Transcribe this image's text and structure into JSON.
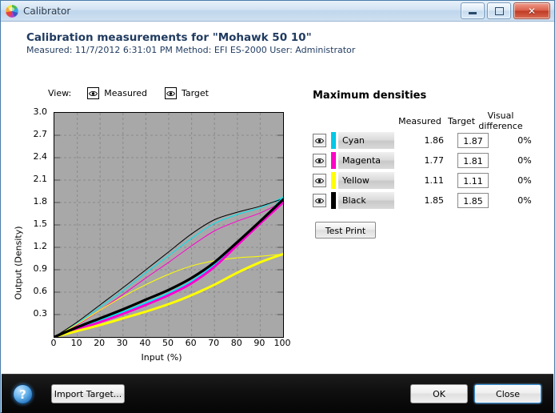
{
  "window": {
    "title": "Calibrator",
    "icon": "color-wheel-icon",
    "buttons": {
      "minimize": "minimize-icon",
      "maximize": "maximize-icon",
      "close": "close-icon"
    }
  },
  "header": {
    "title": "Calibration measurements for \"Mohawk 50 10\"",
    "subtitle": "Measured: 11/7/2012 6:31:01 PM   Method: EFI ES-2000   User: Administrator"
  },
  "view": {
    "label": "View:",
    "options": [
      {
        "label": "Measured",
        "icon": "eye-icon",
        "enabled": true
      },
      {
        "label": "Target",
        "icon": "eye-icon",
        "enabled": true
      }
    ]
  },
  "panel": {
    "title": "Maximum densities",
    "columns": [
      "Measured",
      "Target",
      "Visual difference"
    ],
    "column_visual_line1": "Visual",
    "column_visual_line2": "difference",
    "rows": [
      {
        "name": "Cyan",
        "color": "#00c8e6",
        "measured": "1.86",
        "target": "1.87",
        "visual_difference": "0%",
        "icon": "eye-icon"
      },
      {
        "name": "Magenta",
        "color": "#ff00c8",
        "measured": "1.77",
        "target": "1.81",
        "visual_difference": "0%",
        "icon": "eye-icon"
      },
      {
        "name": "Yellow",
        "color": "#ffff00",
        "measured": "1.11",
        "target": "1.11",
        "visual_difference": "0%",
        "icon": "eye-icon"
      },
      {
        "name": "Black",
        "color": "#000000",
        "measured": "1.85",
        "target": "1.85",
        "visual_difference": "0%",
        "icon": "eye-icon"
      }
    ],
    "test_print_label": "Test Print"
  },
  "footer": {
    "help_label": "?",
    "import_label": "Import Target...",
    "ok_label": "OK",
    "close_label": "Close"
  },
  "chart_data": {
    "type": "line",
    "title": "",
    "xlabel": "Input (%)",
    "ylabel": "Output (Density)",
    "xlim": [
      0,
      100
    ],
    "ylim": [
      0,
      3.0
    ],
    "xticks": [
      0,
      10,
      20,
      30,
      40,
      50,
      60,
      70,
      80,
      90,
      100
    ],
    "yticks": [
      "0.3",
      "0.6",
      "0.9",
      "1.2",
      "1.5",
      "1.8",
      "2.1",
      "2.4",
      "2.7",
      "3.0"
    ],
    "grid": true,
    "plot_background": "#a8a8a8",
    "legend": "none",
    "x": [
      0,
      10,
      20,
      30,
      40,
      50,
      60,
      70,
      80,
      90,
      100
    ],
    "series": [
      {
        "name": "Cyan measured",
        "color": "#00e5f0",
        "width": 3,
        "style": "measured",
        "values": [
          0.0,
          0.11,
          0.22,
          0.33,
          0.45,
          0.58,
          0.74,
          0.96,
          1.24,
          1.53,
          1.86
        ]
      },
      {
        "name": "Magenta measured",
        "color": "#ff00d0",
        "width": 3,
        "style": "measured",
        "values": [
          0.0,
          0.1,
          0.2,
          0.31,
          0.43,
          0.56,
          0.72,
          0.94,
          1.23,
          1.52,
          1.8
        ]
      },
      {
        "name": "Yellow measured",
        "color": "#ffff00",
        "width": 3,
        "style": "measured",
        "values": [
          0.0,
          0.08,
          0.16,
          0.25,
          0.34,
          0.44,
          0.56,
          0.7,
          0.86,
          1.0,
          1.11
        ]
      },
      {
        "name": "Black measured",
        "color": "#000000",
        "width": 3.2,
        "style": "measured",
        "values": [
          0.0,
          0.13,
          0.25,
          0.37,
          0.5,
          0.63,
          0.79,
          1.0,
          1.27,
          1.55,
          1.84
        ]
      },
      {
        "name": "Cyan target",
        "color": "#00e5f0",
        "width": 1,
        "style": "target",
        "values": [
          0.0,
          0.18,
          0.4,
          0.62,
          0.86,
          1.09,
          1.32,
          1.52,
          1.64,
          1.73,
          1.87
        ]
      },
      {
        "name": "Magenta target",
        "color": "#ff00d0",
        "width": 1,
        "style": "target",
        "values": [
          0.0,
          0.16,
          0.36,
          0.57,
          0.79,
          1.0,
          1.22,
          1.42,
          1.55,
          1.66,
          1.81
        ]
      },
      {
        "name": "Yellow target",
        "color": "#ffff00",
        "width": 1,
        "style": "target",
        "values": [
          0.0,
          0.17,
          0.36,
          0.54,
          0.7,
          0.84,
          0.95,
          1.02,
          1.06,
          1.08,
          1.11
        ]
      },
      {
        "name": "Black target",
        "color": "#000000",
        "width": 1,
        "style": "target",
        "values": [
          0.0,
          0.2,
          0.43,
          0.66,
          0.9,
          1.14,
          1.38,
          1.57,
          1.67,
          1.75,
          1.85
        ]
      }
    ]
  }
}
